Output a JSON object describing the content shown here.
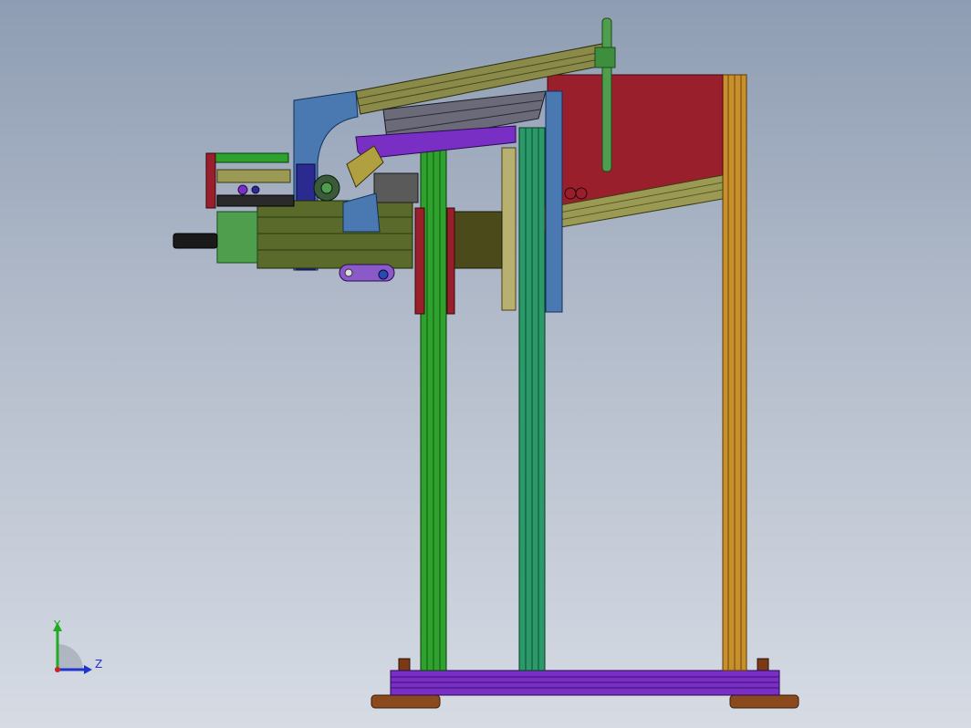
{
  "view": {
    "background_top": "#8e9db3",
    "background_bottom": "#d6dbe4"
  },
  "triad": {
    "y_label": "Y",
    "z_label": "Z",
    "y_color": "#22aa22",
    "z_color": "#2233cc",
    "x_color": "#cc2222"
  },
  "model_colors": {
    "frame_orange": "#c8902a",
    "frame_green": "#2ea12e",
    "frame_teal": "#2b9a6a",
    "base_purple": "#7a2fc4",
    "feet_brown": "#8a4a1e",
    "panel_red": "#9a1f2c",
    "rail_olive": "#9a9a55",
    "plate_blue": "#4a78b0",
    "motor_green": "#4e9e4e"
  }
}
